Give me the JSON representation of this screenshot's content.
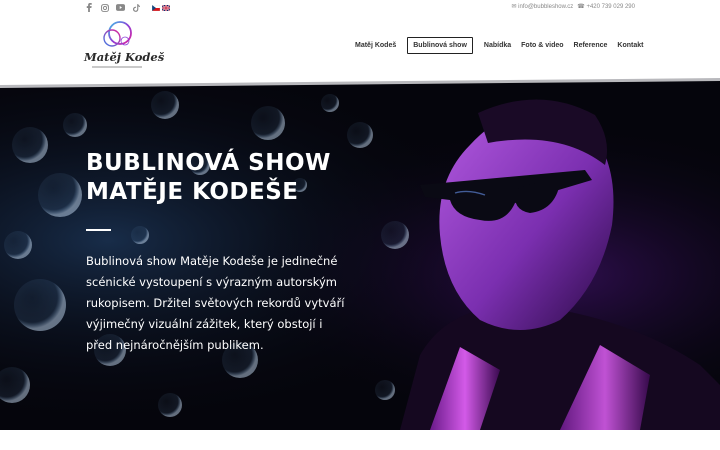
{
  "topbar": {
    "social_icons": [
      "facebook-icon",
      "instagram-icon",
      "youtube-icon",
      "tiktok-icon"
    ],
    "languages": [
      "cz",
      "en"
    ],
    "email": "✉ info@bubbleshow.cz",
    "phone": "☎ +420 739 029 290"
  },
  "logo": {
    "text": "Matěj Kodeš"
  },
  "nav": {
    "items": [
      {
        "label": "Matěj Kodeš"
      },
      {
        "label": "Bublinová show"
      },
      {
        "label": "Nabídka"
      },
      {
        "label": "Foto & video"
      },
      {
        "label": "Reference"
      },
      {
        "label": "Kontakt"
      }
    ],
    "active_index": 1
  },
  "hero": {
    "title_line1": "BUBLINOVÁ SHOW",
    "title_line2": "MATĚJE KODEŠE",
    "text": "Bublinová show Matěje Kodeše je jedinečné scénické vystoupení s výrazným autorským rukopisem. Držitel světových rekordů vytváří výjimečný vizuální zážitek, který obstojí i před nejnáročnějším publikem."
  },
  "colors": {
    "accent_purple": "#8b3fd8",
    "accent_pink": "#e0209a",
    "hero_bg": "#05050c"
  }
}
